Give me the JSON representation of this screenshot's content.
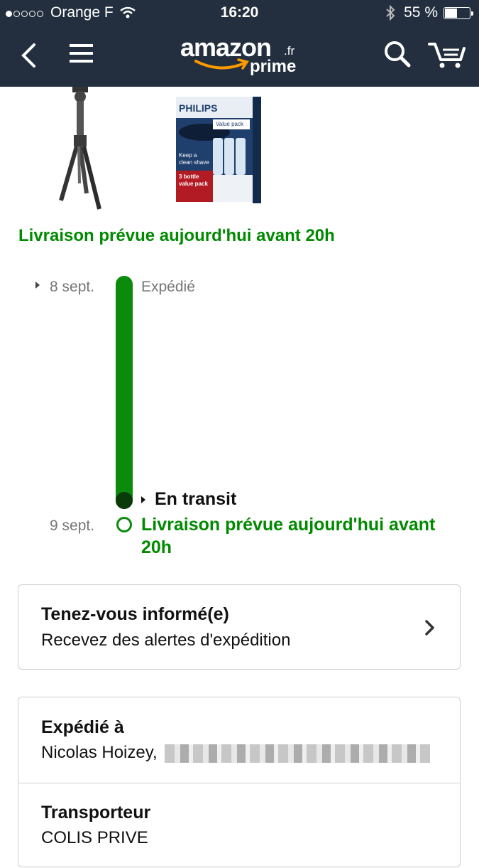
{
  "status_bar": {
    "carrier": "Orange F",
    "time": "16:20",
    "battery": "55 %",
    "battery_level": 0.55
  },
  "nav": {
    "logo_word": "amazon",
    "logo_tld": ".fr",
    "logo_sub": "prime",
    "icons": [
      "back-icon",
      "menu-icon",
      "search-icon",
      "cart-icon"
    ]
  },
  "products": [
    {
      "name": "tripod-image"
    },
    {
      "name": "philips-cleaning-pack-image",
      "brand": "PHILIPS",
      "tag": "Value pack",
      "tagline": "Keep a clean shave",
      "pack": "3 bottle value pack"
    }
  ],
  "delivery": {
    "title": "Livraison prévue aujourd'hui avant 20h"
  },
  "timeline": {
    "steps": [
      {
        "date": "8 sept.",
        "label": "Expédié"
      },
      {
        "date": "",
        "label": "En transit"
      },
      {
        "date": "9 sept.",
        "label": "Livraison prévue aujourd'hui avant 20h"
      }
    ]
  },
  "alerts_card": {
    "title": "Tenez-vous informé(e)",
    "subtitle": "Recevez des alertes d'expédition"
  },
  "shipping_card": {
    "shipped_to_label": "Expédié à",
    "recipient": "Nicolas Hoizey,",
    "carrier_label": "Transporteur",
    "carrier": "COLIS PRIVE"
  },
  "colors": {
    "header": "#232f3e",
    "green": "#008a00",
    "accent_orange": "#ff9900"
  }
}
